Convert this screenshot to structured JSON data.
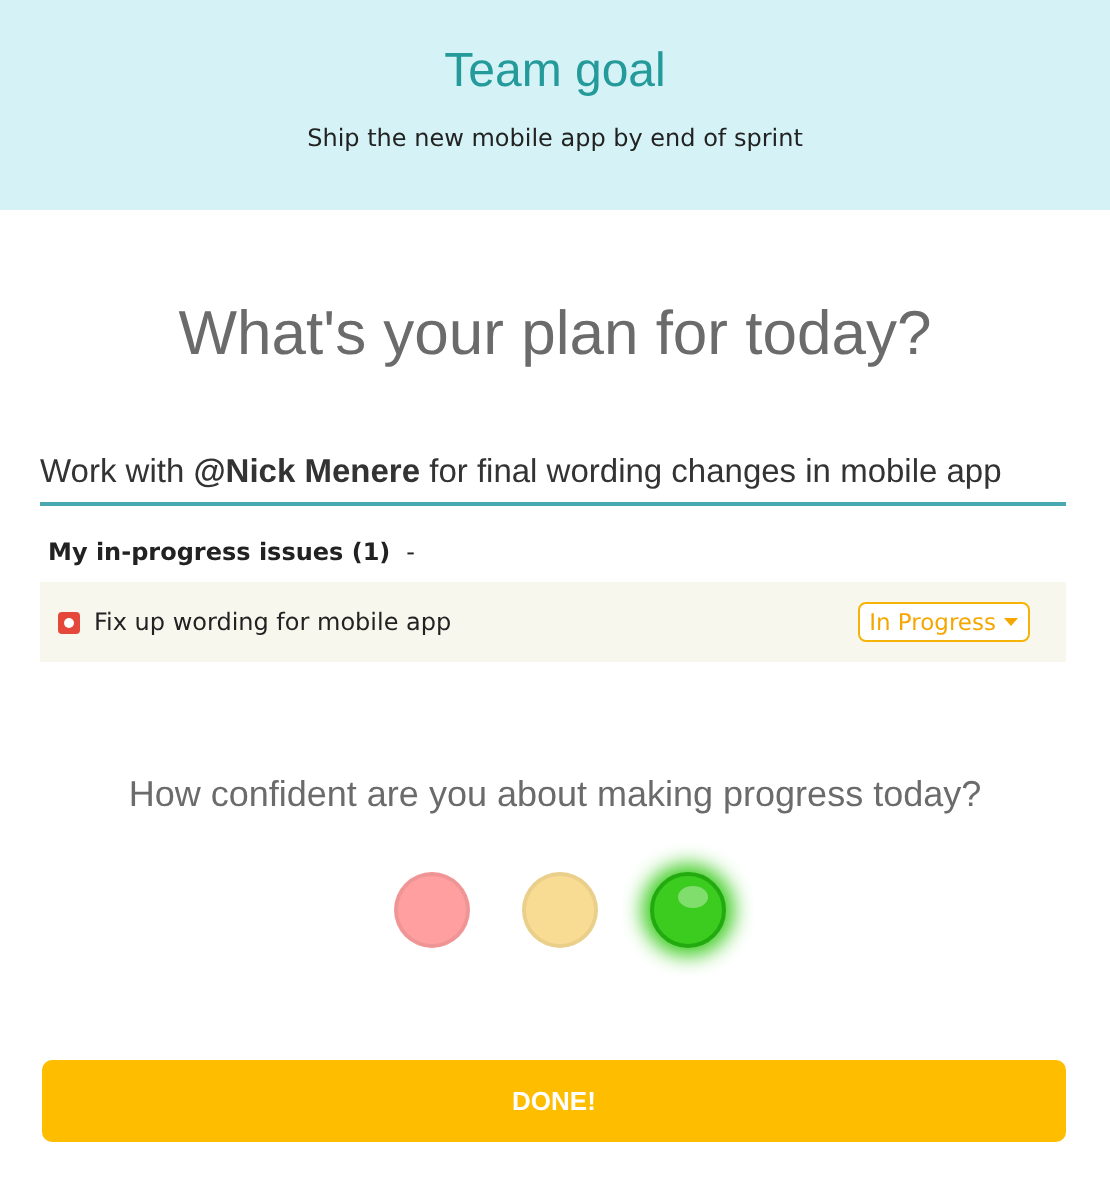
{
  "team_goal": {
    "title": "Team goal",
    "subtitle": "Ship the new mobile app by end of sprint"
  },
  "question": "What's your plan for today?",
  "plan": {
    "value": "Work with **@Nick Menere** for final wording changes in mobile app"
  },
  "issues": {
    "heading": "My in-progress issues (1)",
    "toggle": "-",
    "items": [
      {
        "title": "Fix up wording for mobile app",
        "status": "In Progress"
      }
    ]
  },
  "confidence": {
    "question": "How confident are you about making progress today?",
    "options": [
      {
        "color": "#ff9f9f",
        "selected": false
      },
      {
        "color": "#f9dc94",
        "selected": false
      },
      {
        "color": "#3ccc1f",
        "selected": true
      }
    ]
  },
  "button": "DONE!"
}
